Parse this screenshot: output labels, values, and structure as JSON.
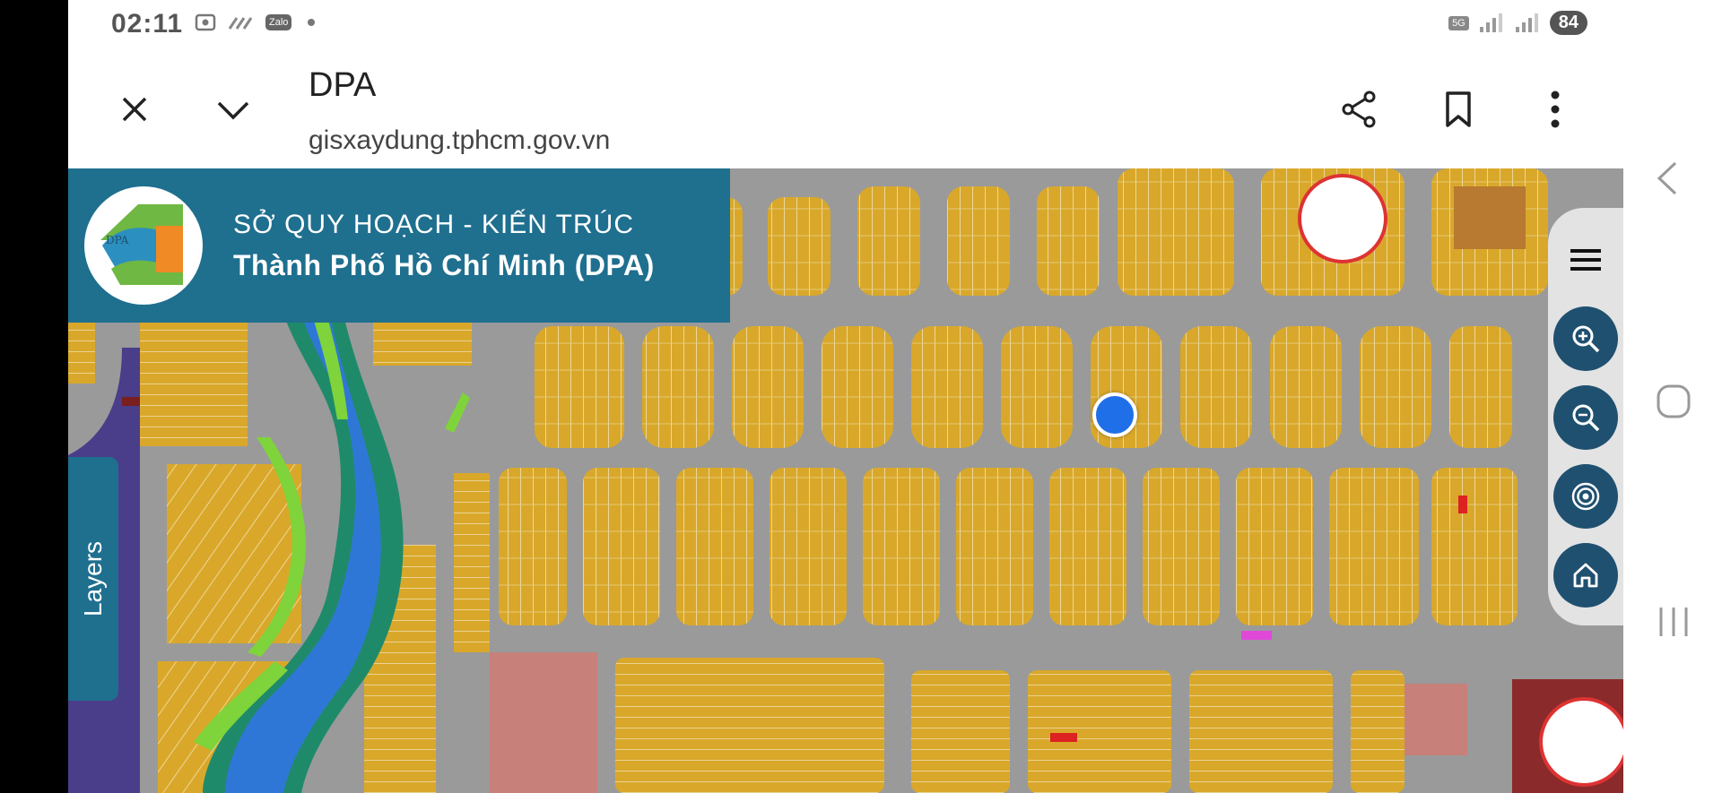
{
  "status": {
    "time": "02:11",
    "left_icons": [
      "screenshot-icon",
      "wifi-call-icon",
      "zalo-icon",
      "dot-icon"
    ],
    "zalo_label": "Zalo",
    "network": "5G",
    "battery": "84"
  },
  "browser": {
    "title": "DPA",
    "url": "gisxaydung.tphcm.gov.vn"
  },
  "banner": {
    "logo_text": "DPA",
    "line1": "SỞ QUY HOẠCH - KIẾN TRÚC",
    "line2": "Thành Phố Hồ Chí Minh (DPA)"
  },
  "layers_label": "Layers",
  "colors": {
    "parcel": "#d9a82a",
    "road": "#9a9a9a",
    "panel": "#1f6f8f",
    "canal_blue": "#2f77d6",
    "canal_green": "#7ed43a",
    "canal_dark": "#1f8a6a",
    "river": "#4a3d8a",
    "pink_parcel": "#c7807a",
    "button": "#1f5070",
    "location": "#1f6fe8"
  },
  "map_tools": [
    "menu-icon",
    "zoom-in-icon",
    "zoom-out-icon",
    "locate-icon",
    "home-icon"
  ]
}
